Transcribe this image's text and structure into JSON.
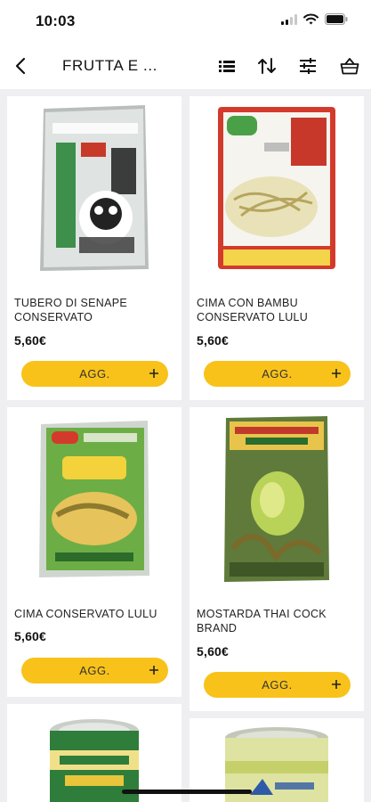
{
  "status_bar": {
    "time": "10:03",
    "icons": [
      "signal-icon",
      "wifi-icon",
      "battery-icon"
    ]
  },
  "nav": {
    "title": "FRUTTA E ...",
    "icons": [
      "back-arrow-icon",
      "list-view-icon",
      "sort-icon",
      "filter-icon",
      "basket-icon"
    ]
  },
  "products": [
    {
      "name": "TUBERO DI SENAPE CONSERVATO",
      "price": "5,60€",
      "button_label": "AGG.",
      "image": "product-package-image"
    },
    {
      "name": "CIMA CON BAMBU CONSERVATO LULU",
      "price": "5,60€",
      "button_label": "AGG.",
      "image": "product-package-image"
    },
    {
      "name": "CIMA CONSERVATO LULU",
      "price": "5,60€",
      "button_label": "AGG.",
      "image": "product-package-image"
    },
    {
      "name": "MOSTARDA THAI COCK BRAND",
      "price": "5,60€",
      "button_label": "AGG.",
      "image": "product-package-image"
    },
    {
      "name": "",
      "price": "",
      "button_label": "",
      "image": "canned-corn-image"
    },
    {
      "name": "",
      "price": "",
      "button_label": "",
      "image": "canned-goods-image"
    }
  ],
  "colors": {
    "accent": "#f8c21a",
    "background": "#efeff2",
    "card": "#ffffff"
  }
}
